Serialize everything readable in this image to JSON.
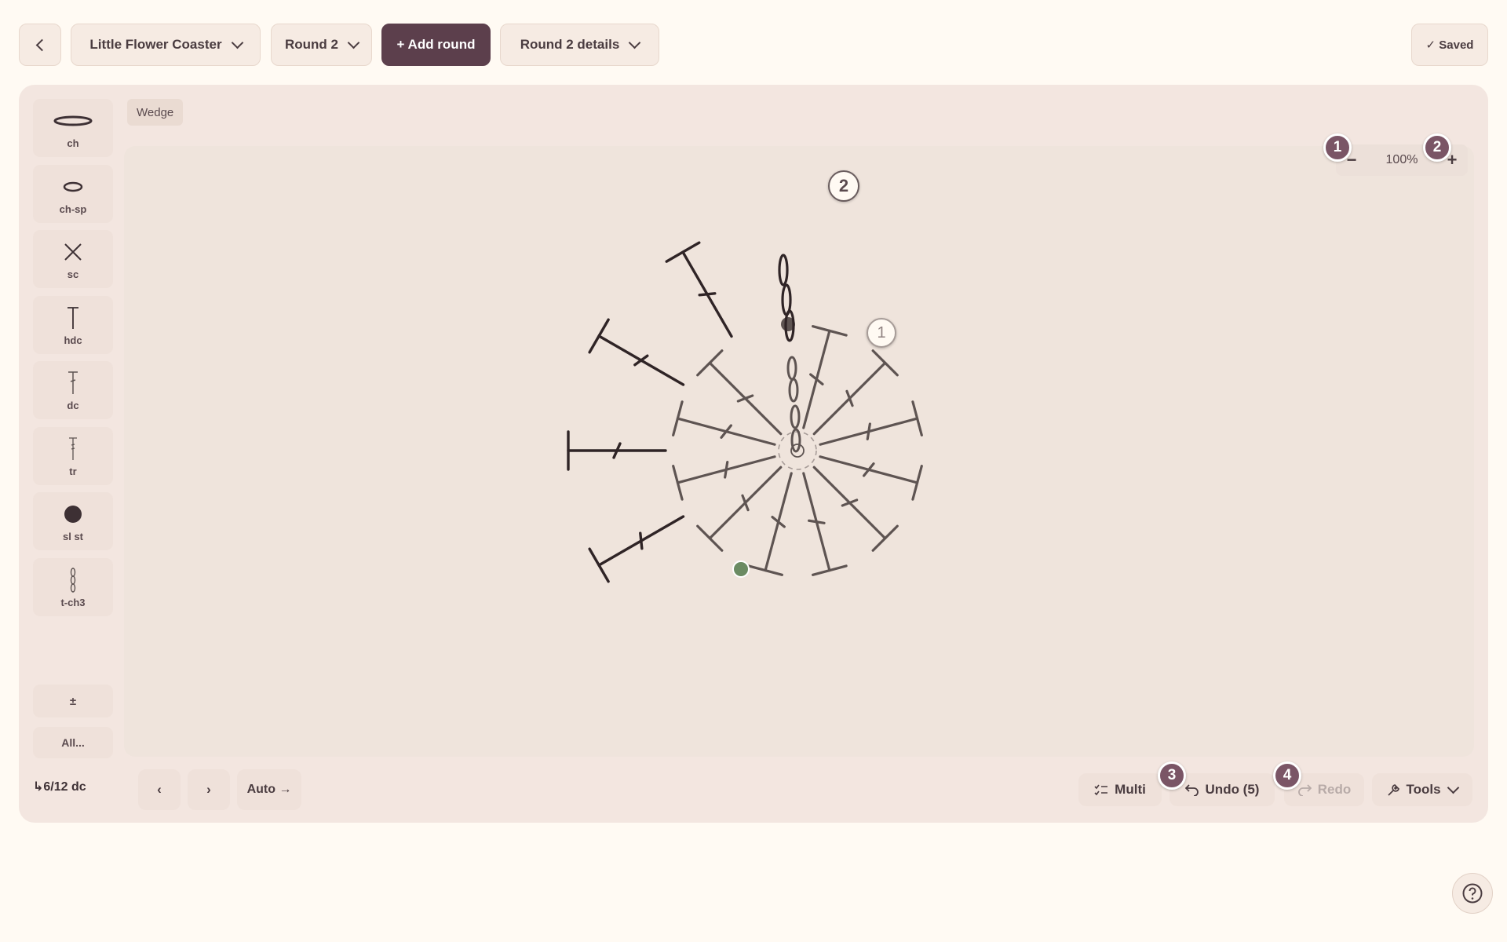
{
  "header": {
    "pattern_name": "Little Flower Coaster",
    "round_select": "Round 2",
    "add_round_label": "+ Add round",
    "round_details_label": "Round 2 details",
    "saved_label": "✓ Saved"
  },
  "palette": {
    "items": [
      {
        "label": "ch"
      },
      {
        "label": "ch-sp"
      },
      {
        "label": "sc"
      },
      {
        "label": "hdc"
      },
      {
        "label": "dc"
      },
      {
        "label": "tr"
      },
      {
        "label": "sl st"
      },
      {
        "label": "t-ch3"
      }
    ],
    "adjust_label": "±",
    "all_label": "All..."
  },
  "canvas": {
    "wedge_label": "Wedge",
    "zoom": "100%",
    "zoom_out": "−",
    "zoom_in": "+",
    "round_badges": [
      "2",
      "1"
    ]
  },
  "markers": [
    "1",
    "2",
    "3",
    "4"
  ],
  "footer": {
    "stitch_count": "↳6/12 dc",
    "prev_label": "‹",
    "next_label": "›",
    "auto_label": "Auto →",
    "multi_label": "Multi",
    "undo_label": "Undo (5)",
    "redo_label": "Redo",
    "tools_label": "Tools"
  },
  "colors": {
    "accent": "#5c3f4c",
    "marker": "#7a5566",
    "stitch_dark": "#2f2426",
    "stitch_mid": "#5e5452",
    "start_dot": "#6b8b63"
  }
}
